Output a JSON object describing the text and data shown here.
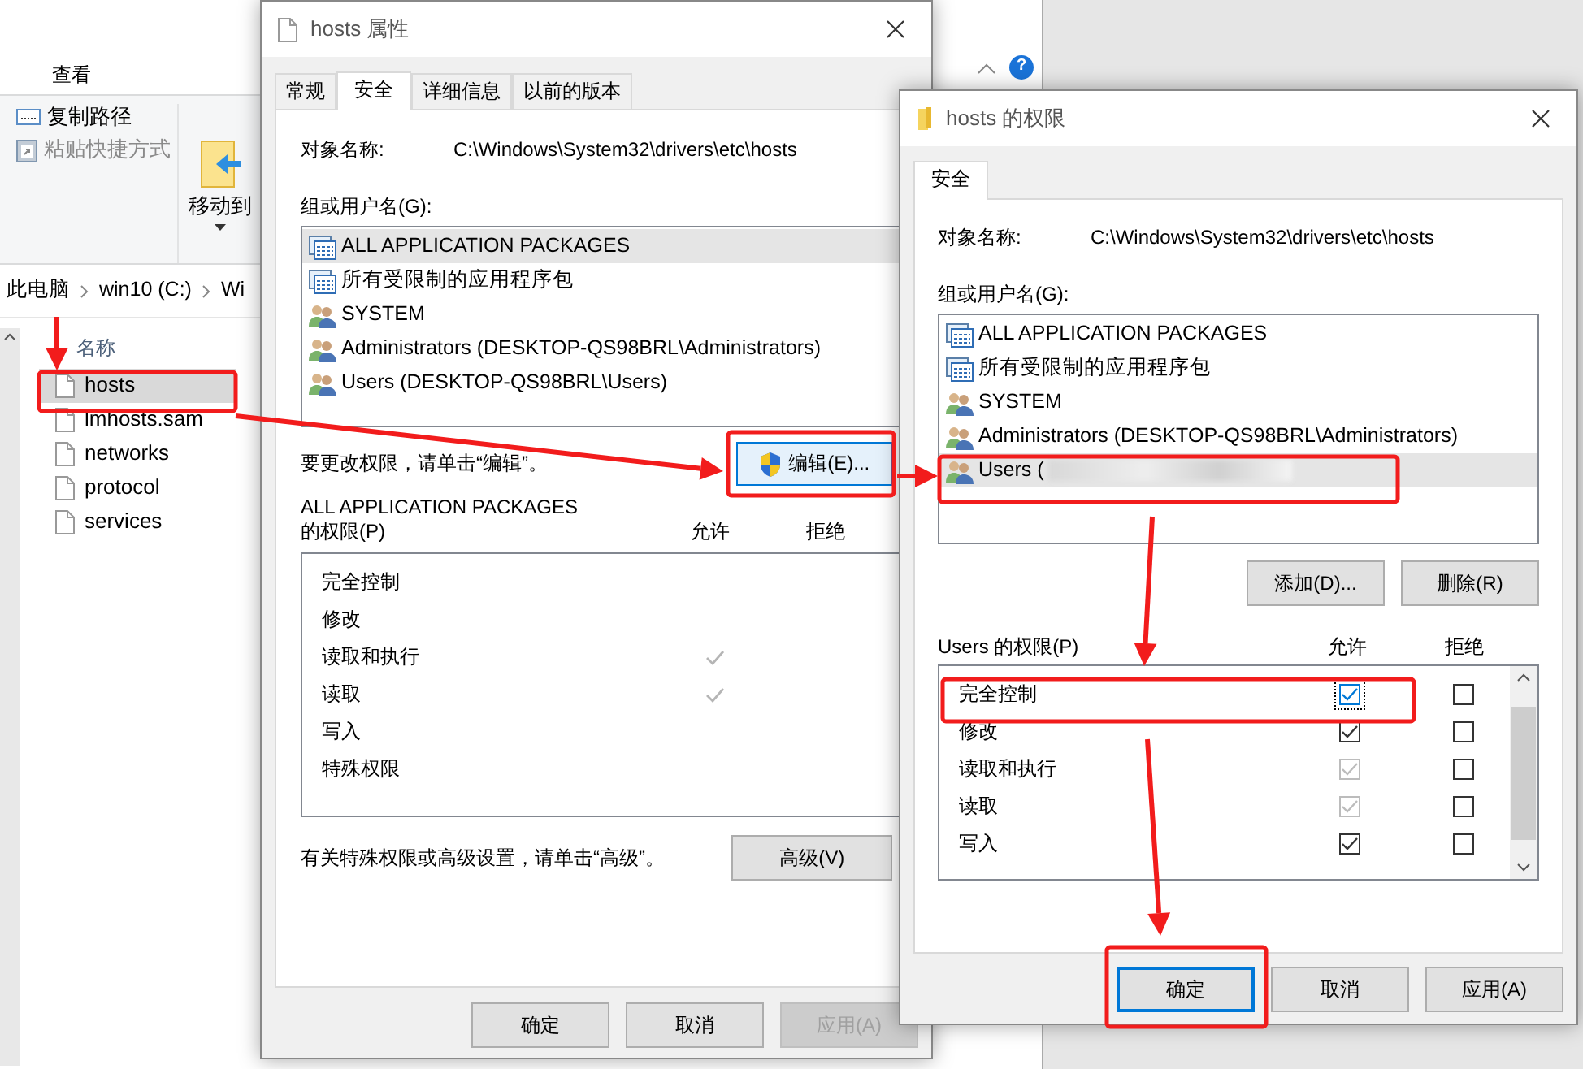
{
  "explorer": {
    "ribbon_tab": "查看",
    "help_glyph": "?",
    "ribbon_items": [
      {
        "label": "复制路径",
        "disabled": false
      },
      {
        "label": "粘贴快捷方式",
        "disabled": true
      }
    ],
    "move_to": "移动到",
    "breadcrumb": [
      "此电脑",
      "win10 (C:)",
      "Wi"
    ],
    "column_header": "名称",
    "files": [
      {
        "name": "hosts",
        "selected": true
      },
      {
        "name": "lmhosts.sam",
        "selected": false
      },
      {
        "name": "networks",
        "selected": false
      },
      {
        "name": "protocol",
        "selected": false
      },
      {
        "name": "services",
        "selected": false
      }
    ]
  },
  "properties_dialog": {
    "title": "hosts 属性",
    "tabs": [
      {
        "label": "常规",
        "selected": false
      },
      {
        "label": "安全",
        "selected": true
      },
      {
        "label": "详细信息",
        "selected": false
      },
      {
        "label": "以前的版本",
        "selected": false
      }
    ],
    "object_label": "对象名称:",
    "object_path": "C:\\Windows\\System32\\drivers\\etc\\hosts",
    "group_label": "组或用户名(G):",
    "principals": [
      {
        "kind": "package",
        "name": "ALL APPLICATION PACKAGES",
        "selected": true
      },
      {
        "kind": "package",
        "name": "所有受限制的应用程序包",
        "selected": false
      },
      {
        "kind": "users",
        "name": "SYSTEM",
        "selected": false
      },
      {
        "kind": "users",
        "name": "Administrators (DESKTOP-QS98BRL\\Administrators)",
        "selected": false
      },
      {
        "kind": "users",
        "name": "Users (DESKTOP-QS98BRL\\Users)",
        "selected": false
      }
    ],
    "edit_hint": "要更改权限，请单击“编辑”。",
    "edit_button": "编辑(E)...",
    "permissions_for": "ALL APPLICATION PACKAGES",
    "permissions_label": "的权限(P)",
    "allow_header": "允许",
    "deny_header": "拒绝",
    "permissions": [
      {
        "name": "完全控制",
        "allow": false
      },
      {
        "name": "修改",
        "allow": false
      },
      {
        "name": "读取和执行",
        "allow": true
      },
      {
        "name": "读取",
        "allow": true
      },
      {
        "name": "写入",
        "allow": false
      },
      {
        "name": "特殊权限",
        "allow": false
      }
    ],
    "advanced_hint": "有关特殊权限或高级设置，请单击“高级”。",
    "advanced_button": "高级(V)",
    "buttons": [
      {
        "label": "确定",
        "disabled": false
      },
      {
        "label": "取消",
        "disabled": false
      },
      {
        "label": "应用(A)",
        "disabled": true
      }
    ]
  },
  "permissions_dialog": {
    "title": "hosts 的权限",
    "tabs": [
      {
        "label": "安全",
        "selected": true
      }
    ],
    "object_label": "对象名称:",
    "object_path": "C:\\Windows\\System32\\drivers\\etc\\hosts",
    "group_label": "组或用户名(G):",
    "principals": [
      {
        "kind": "package",
        "name": "ALL APPLICATION PACKAGES",
        "selected": false,
        "redacted": false
      },
      {
        "kind": "package",
        "name": "所有受限制的应用程序包",
        "selected": false,
        "redacted": false
      },
      {
        "kind": "users",
        "name": "SYSTEM",
        "selected": false,
        "redacted": false
      },
      {
        "kind": "users",
        "name": "Administrators (DESKTOP-QS98BRL\\Administrators)",
        "selected": false,
        "redacted": false
      },
      {
        "kind": "users",
        "name": "Users (",
        "selected": true,
        "redacted": true
      }
    ],
    "list_buttons": [
      "添加(D)...",
      "删除(R)"
    ],
    "permissions_label": "Users 的权限(P)",
    "allow_header": "允许",
    "deny_header": "拒绝",
    "permissions": [
      {
        "name": "完全控制",
        "allow": true,
        "allow_disabled": false,
        "deny": false,
        "focused": true
      },
      {
        "name": "修改",
        "allow": true,
        "allow_disabled": false,
        "deny": false,
        "focused": false
      },
      {
        "name": "读取和执行",
        "allow": true,
        "allow_disabled": true,
        "deny": false,
        "focused": false
      },
      {
        "name": "读取",
        "allow": true,
        "allow_disabled": true,
        "deny": false,
        "focused": false
      },
      {
        "name": "写入",
        "allow": true,
        "allow_disabled": false,
        "deny": false,
        "focused": false
      }
    ],
    "buttons": [
      {
        "label": "确定",
        "default": true
      },
      {
        "label": "取消",
        "default": false
      },
      {
        "label": "应用(A)",
        "default": false
      }
    ]
  }
}
